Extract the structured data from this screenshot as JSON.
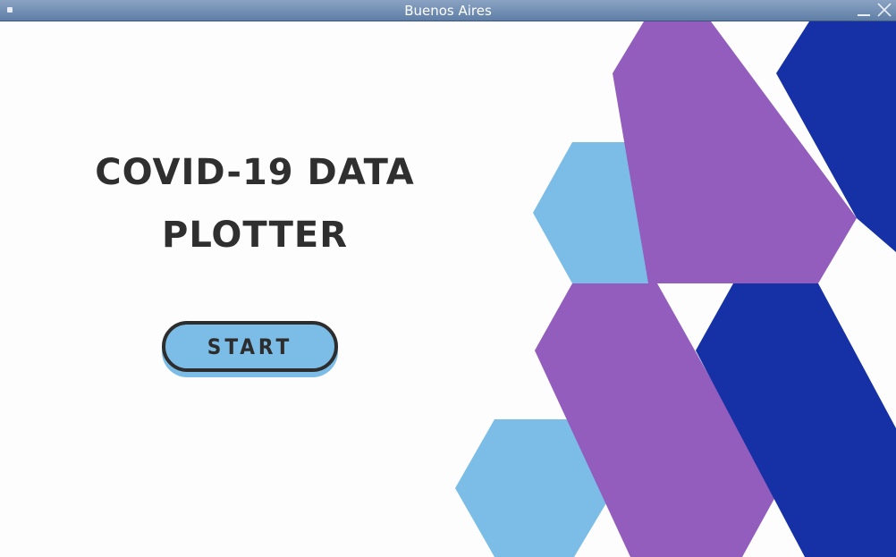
{
  "window": {
    "title": "Buenos Aires"
  },
  "main": {
    "heading_line1": "COVID-19 DATA",
    "heading_line2": "PLOTTER",
    "start_label": "START"
  },
  "colors": {
    "light_blue": "#7bbde6",
    "purple": "#935dbe",
    "dark_blue": "#1630a6",
    "text_dark": "#2f2f2f"
  },
  "icons": {
    "window_menu": "window-menu-icon",
    "minimize": "minimize-icon",
    "close": "close-icon"
  }
}
